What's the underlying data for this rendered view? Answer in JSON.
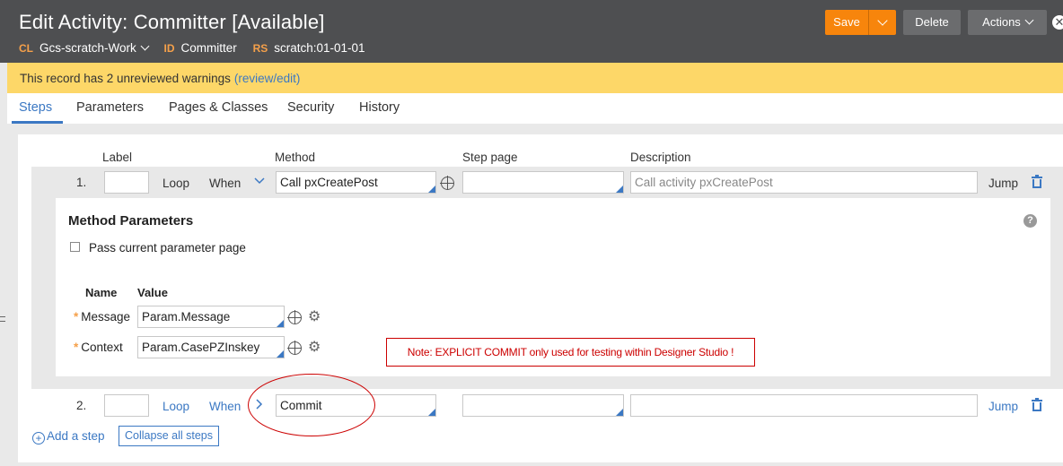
{
  "header": {
    "title": "Edit Activity: Committer [Available]",
    "meta": [
      {
        "key": "CL",
        "value": "Gcs-scratch-Work"
      },
      {
        "key": "ID",
        "value": "Committer"
      },
      {
        "key": "RS",
        "value": "scratch:01-01-01"
      }
    ],
    "buttons": {
      "save": "Save",
      "delete": "Delete",
      "actions": "Actions"
    },
    "close_glyph": "✕"
  },
  "warning": {
    "text": "This record has 2 unreviewed warnings",
    "link": "(review/edit)"
  },
  "tabs": [
    "Steps",
    "Parameters",
    "Pages & Classes",
    "Security",
    "History"
  ],
  "columns": {
    "label": "Label",
    "method": "Method",
    "step_page": "Step page",
    "description": "Description"
  },
  "steps": [
    {
      "number": "1.",
      "label_value": "",
      "loop": "Loop",
      "when": "When",
      "method": "Call pxCreatePost",
      "step_page": "",
      "description_placeholder": "Call activity pxCreatePost",
      "jump": "Jump"
    },
    {
      "number": "2.",
      "label_value": "",
      "loop": "Loop",
      "when": "When",
      "method": "Commit",
      "step_page": "",
      "description_placeholder": "",
      "jump": "Jump"
    }
  ],
  "method_parameters": {
    "title": "Method Parameters",
    "pass_checkbox_label": "Pass current parameter page",
    "pass_checked": false,
    "name_header": "Name",
    "value_header": "Value",
    "params": [
      {
        "name": "Message",
        "value": "Param.Message",
        "required": true
      },
      {
        "name": "Context",
        "value": "Param.CasePZInskey",
        "required": true
      }
    ]
  },
  "note": "Note: EXPLICIT COMMIT only used for testing within Designer Studio !",
  "bottom": {
    "add_step": "Add a step",
    "collapse": "Collapse all steps"
  },
  "colors": {
    "accent": "#3b78c3",
    "save": "#f7850c",
    "warning_bg": "#fdd768",
    "header_bg": "#4e4f51",
    "note_red": "#cc0000"
  },
  "icons": [
    "chevron-down-icon",
    "close-icon",
    "crosshair-icon",
    "gear-icon",
    "trash-icon",
    "help-icon",
    "chevron-right-icon",
    "add-circle-icon"
  ]
}
